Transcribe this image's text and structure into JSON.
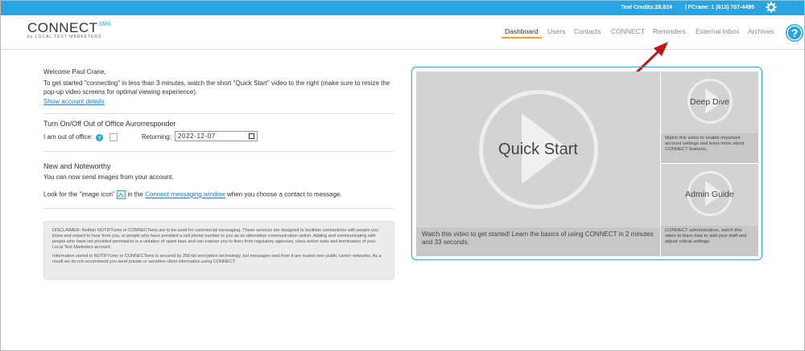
{
  "topbar": {
    "credits": "Text Credits:28,824",
    "separator": "|",
    "user": "PCrane: 1 (613) 707-4495",
    "settings_icon": "gear-icon"
  },
  "logo": {
    "main": "CONNECT",
    "sms": "SMS",
    "tagline": "by LOCAL TEXT MARKETERS"
  },
  "nav": {
    "items": [
      "Dashboard",
      "Users",
      "Contacts",
      "CONNECT",
      "Reminders",
      "External Inbox",
      "Archives"
    ],
    "active": "Dashboard"
  },
  "help_icon": "question-mark-icon",
  "welcome": {
    "greeting": "Welcome Paul Crane,",
    "intro": "To get started \"connecting\" in less than 3 minutes, watch the short \"Quick Start\" video to the right (make sure to resize the pop-up video screens for optimal viewing experience).",
    "account_link": "Show account details"
  },
  "out_of_office": {
    "title": "Turn On/Off Out of Office Aurorresponder",
    "label": "I am out of office:",
    "returning_label": "Returning:",
    "returning_value": "2022-12-07"
  },
  "news": {
    "title": "New and Noteworthy",
    "line1": "You can now send images from your account.",
    "line2_before": "Look for the \"image icon\"",
    "line2_link": "Connect messaging window",
    "line2_middle": "in the",
    "line2_after": "when you choose a contact to message."
  },
  "disclaimer": {
    "p1": "DISCLAIMER: Neither NOTIFYsms or CONNECTsms are to be used for commercial messaging. These services are designed to facilitate connections with people you know and expect to hear from you, or people who have provided a cell phone number to you as an alternative communication option. Adding and communicating with people who have not provided permission is a violation of spam laws and can expose you to fines from regulatory agencies, class action suits and termination of your Local Text Marketers account.",
    "p2": "Information stored in NOTIFYsms or CONNECTsms is secured by 256-bit encryption technology, but messages sent from it are routed over public carrier networks. As a result we do not recommend you send private or sensitive client information using CONNECT."
  },
  "videos": {
    "main": {
      "title": "Quick Start",
      "caption": "Watch this video to get started! Learn the basics of using CONNECT in 2 minutes and 33 seconds."
    },
    "side": [
      {
        "title": "Deep Dive",
        "caption": "Watch this video to enable important account settings and learn more about CONNECT features."
      },
      {
        "title": "Admin Guide",
        "caption": "CONNECT administrators, watch this video to learn how to add your staff and adjust critical settings."
      }
    ]
  },
  "colors": {
    "accent": "#2aa4e0",
    "active_underline": "#f0a030",
    "annotation_arrow": "#c0161e"
  }
}
